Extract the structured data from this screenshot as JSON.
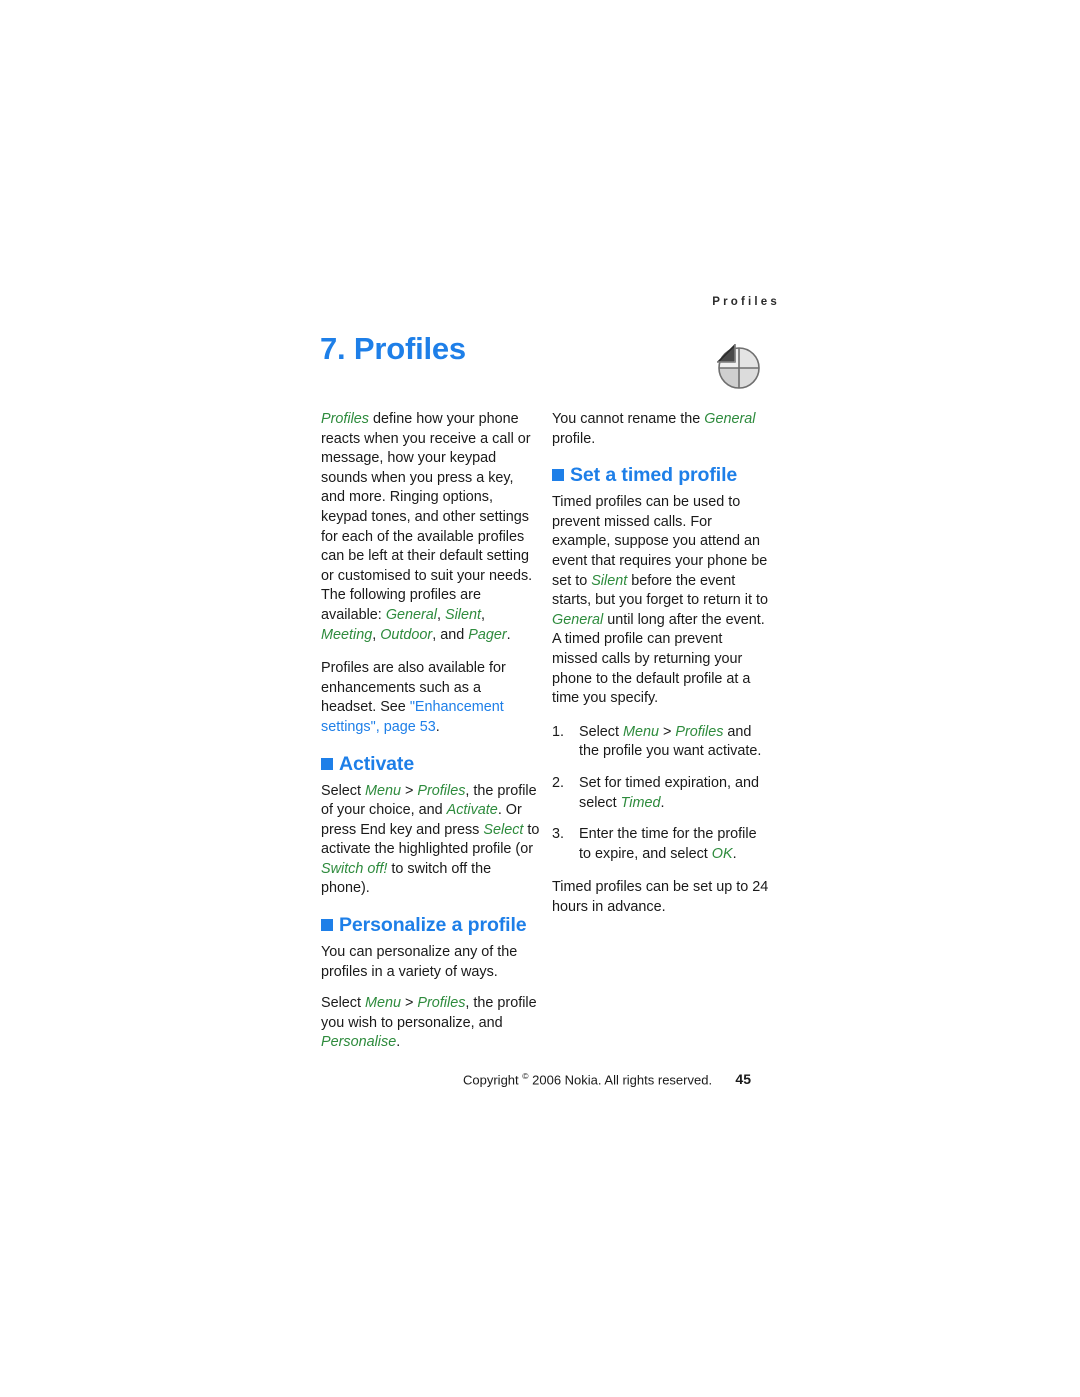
{
  "document": {
    "running_header": "Profiles",
    "chapter_title": "7. Profiles",
    "chapter_icon": "profiles-quadrant-icon"
  },
  "colors": {
    "heading_blue": "#1E7FE8",
    "ui_term_green": "#2E8B3D",
    "crossref_blue": "#1E7FE8",
    "body_text": "#1a1a1a",
    "page_background": "#ffffff"
  },
  "left_column": {
    "intro": {
      "part1": "Profiles",
      "part2": " define how your phone reacts when you receive a call or message, how your keypad sounds when you press a key, and more. Ringing options, keypad tones, and other settings for each of the available profiles can be left at their default setting or customised to suit your needs. The following profiles are available: ",
      "profile_general": "General",
      "sep1": ", ",
      "profile_silent": "Silent",
      "sep2": ", ",
      "profile_meeting": "Meeting",
      "sep3": ", ",
      "profile_outdoor": "Outdoor",
      "sep4": ", and ",
      "profile_pager": "Pager",
      "end": "."
    },
    "enhancements": {
      "text": "Profiles are also available for enhancements such as a headset. See ",
      "link": "\"Enhancement settings\", page 53",
      "end": "."
    },
    "activate": {
      "heading": "Activate",
      "p1_a": "Select ",
      "p1_menu": "Menu",
      "p1_b": " > ",
      "p1_profiles": "Profiles",
      "p1_c": ", the profile of your choice, and ",
      "p1_activate": "Activate",
      "p1_d": ". Or press End key and press ",
      "p1_select": "Select",
      "p1_e": " to activate the highlighted profile (or ",
      "p1_switchoff": "Switch off!",
      "p1_f": " to switch off the phone)."
    },
    "personalize": {
      "heading": "Personalize a profile",
      "p1": "You can personalize any of the profiles in a variety of ways.",
      "p2_a": "Select ",
      "p2_menu": "Menu",
      "p2_b": " > ",
      "p2_profiles": "Profiles",
      "p2_c": ", the profile you wish to personalize, and ",
      "p2_personalise": "Personalise",
      "p2_d": "."
    }
  },
  "right_column": {
    "rename_note": {
      "a": "You cannot rename the ",
      "general": "General",
      "b": " profile."
    },
    "timed": {
      "heading": "Set a timed profile",
      "p1_a": "Timed profiles can be used to prevent missed calls. For example, suppose you attend an event that requires your phone be set to ",
      "p1_silent": "Silent",
      "p1_b": " before the event starts, but you forget to return it to ",
      "p1_general": "General",
      "p1_c": " until long after the event. A timed profile can prevent missed calls by returning your phone to the default profile at a time you specify.",
      "steps": [
        {
          "num": "1.",
          "a": "Select ",
          "menu": "Menu",
          "b": " > ",
          "profiles": "Profiles",
          "c": " and the profile you want activate."
        },
        {
          "num": "2.",
          "a": "Set for timed expiration, and select ",
          "term": "Timed",
          "c": "."
        },
        {
          "num": "3.",
          "a": "Enter the time for the profile to expire, and select ",
          "term": "OK",
          "c": "."
        }
      ],
      "closing": "Timed profiles can be set up to 24 hours in advance."
    }
  },
  "footer": {
    "copyright_prefix": "Copyright ",
    "copyright_symbol": "©",
    "copyright_rest": " 2006 Nokia. All rights reserved.",
    "page_number": "45"
  }
}
